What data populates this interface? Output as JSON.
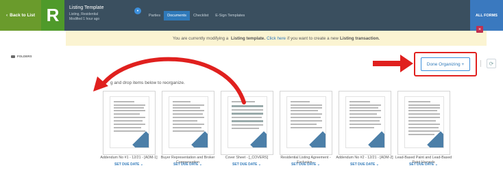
{
  "topbar": {
    "back_label": "Back to List",
    "logo_letter": "R",
    "template_title": "Listing Template",
    "template_type": "Listing, Residential",
    "modified": "Modified 1 hour ago",
    "tabs": [
      {
        "label": "Parties"
      },
      {
        "label": "Documents"
      },
      {
        "label": "Checklist"
      },
      {
        "label": "E-Sign Templates"
      }
    ],
    "all_forms": "ALL FORMS"
  },
  "banner": {
    "prefix": "You are currently modifying a",
    "template_word": "Listing template.",
    "link": "Click here",
    "middle": "if you want to create a new",
    "transaction_word": "Listing transaction."
  },
  "folders_label": "FOLDERS",
  "done_button": "Done Organizing",
  "instruction": "g and drop items below to reorganize.",
  "documents": [
    {
      "title": "Addendum No #1 - 12/21 - [ADM-1]",
      "due": "SET DUE DATE"
    },
    {
      "title": "Buyer Representation and Broker Compensation",
      "due": "SET DUE DATE"
    },
    {
      "title": "Cover Sheet - [_COVERS]",
      "due": "SET DUE DATE"
    },
    {
      "title": "Residential Listing Agreement - Exclusive -",
      "due": "SET DUE DATE"
    },
    {
      "title": "Addendum No #2 - 12/21 - [ADM-2]",
      "due": "SET DUE DATE"
    },
    {
      "title": "Lead-Based Paint and Lead-Based Paint Hazards",
      "due": "SET DUE DATE"
    }
  ],
  "colors": {
    "topbar": "#3a4f5f",
    "back": "#6a9b2c",
    "accent": "#2f79b9",
    "highlight_red": "#e0201e"
  }
}
